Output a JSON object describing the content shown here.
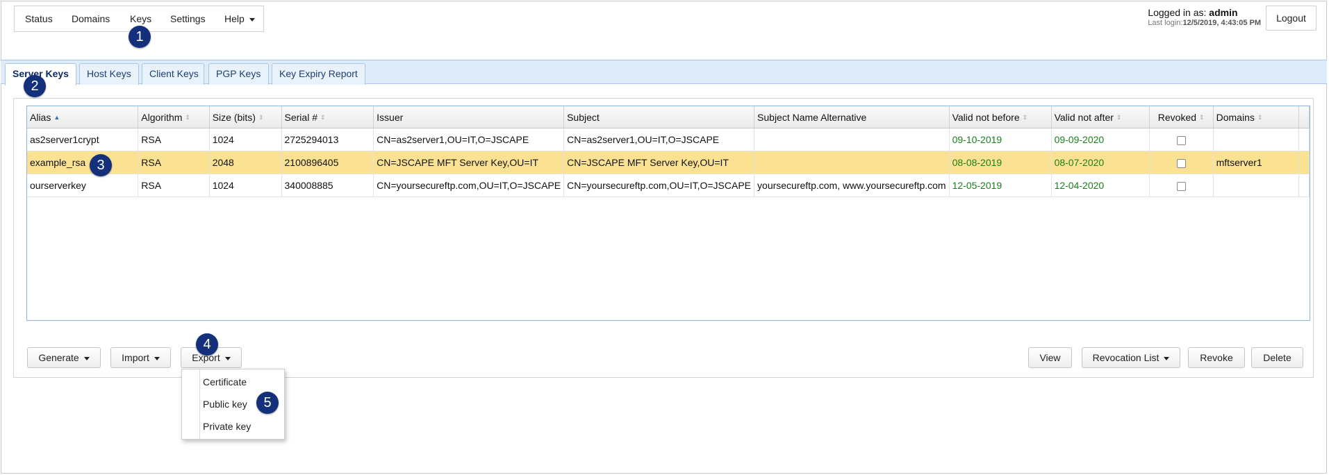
{
  "nav": {
    "items": [
      {
        "label": "Status"
      },
      {
        "label": "Domains"
      },
      {
        "label": "Keys"
      },
      {
        "label": "Settings"
      },
      {
        "label": "Help"
      }
    ]
  },
  "user": {
    "logged_in_prefix": "Logged in as:",
    "username": "admin",
    "last_login_prefix": "Last login:",
    "last_login_value": "12/5/2019, 4:43:05 PM",
    "logout_label": "Logout"
  },
  "tabs": [
    {
      "label": "Server Keys",
      "active": true
    },
    {
      "label": "Host Keys"
    },
    {
      "label": "Client Keys"
    },
    {
      "label": "PGP Keys"
    },
    {
      "label": "Key Expiry Report"
    }
  ],
  "table": {
    "columns": [
      "Alias",
      "Algorithm",
      "Size (bits)",
      "Serial #",
      "Issuer",
      "Subject",
      "Subject Name Alternative",
      "Valid not before",
      "Valid not after",
      "Revoked",
      "Domains"
    ],
    "rows": [
      {
        "alias": "as2server1crypt",
        "algorithm": "RSA",
        "size": "1024",
        "serial": "2725294013",
        "issuer": "CN=as2server1,OU=IT,O=JSCAPE",
        "subject": "CN=as2server1,OU=IT,O=JSCAPE",
        "san": "",
        "valid_from": "09-10-2019",
        "valid_to": "09-09-2020",
        "revoked": false,
        "domains": ""
      },
      {
        "alias": "example_rsa",
        "algorithm": "RSA",
        "size": "2048",
        "serial": "2100896405",
        "issuer": "CN=JSCAPE MFT Server Key,OU=IT",
        "subject": "CN=JSCAPE MFT Server Key,OU=IT",
        "san": "",
        "valid_from": "08-08-2019",
        "valid_to": "08-07-2020",
        "revoked": false,
        "domains": "mftserver1",
        "selected": true
      },
      {
        "alias": "ourserverkey",
        "algorithm": "RSA",
        "size": "1024",
        "serial": "340008885",
        "issuer": "CN=yoursecureftp.com,OU=IT,O=JSCAPE",
        "subject": "CN=yoursecureftp.com,OU=IT,O=JSCAPE",
        "san": "yoursecureftp.com, www.yoursecureftp.com",
        "valid_from": "12-05-2019",
        "valid_to": "12-04-2020",
        "revoked": false,
        "domains": ""
      }
    ]
  },
  "actions": {
    "generate": "Generate",
    "import": "Import",
    "export": "Export",
    "view": "View",
    "revocation_list": "Revocation List",
    "revoke": "Revoke",
    "delete": "Delete"
  },
  "export_menu": [
    "Certificate",
    "Public key",
    "Private key"
  ],
  "markers": [
    "1",
    "2",
    "3",
    "4",
    "5"
  ],
  "colors": {
    "selected_row": "#fbe293",
    "valid_dates": "#1a7f1a",
    "tab_strip": "#deebf8",
    "marker": "#14307a"
  }
}
